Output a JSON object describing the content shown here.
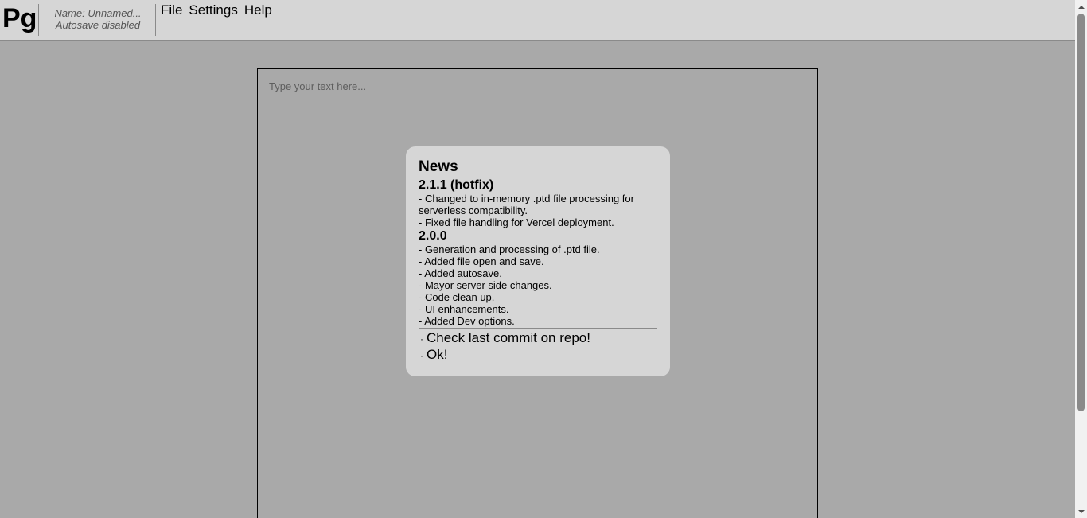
{
  "app": {
    "logo": "Pg",
    "file_name": "Name: Unnamed...",
    "autosave_status": "Autosave disabled"
  },
  "menu": {
    "items": [
      {
        "label": "File"
      },
      {
        "label": "Settings"
      },
      {
        "label": "Help"
      }
    ]
  },
  "editor": {
    "placeholder": "Type your text here..."
  },
  "news_modal": {
    "title": "News",
    "releases": [
      {
        "version": "2.1.1 (hotfix)",
        "changes": [
          "- Changed to in-memory .ptd file processing for serverless compatibility.",
          "- Fixed file handling for Vercel deployment."
        ]
      },
      {
        "version": "2.0.0",
        "changes": [
          "- Generation and processing of .ptd file.",
          "- Added file open and save.",
          "- Added autosave.",
          "- Mayor server side changes.",
          "- Code clean up.",
          "- UI enhancements.",
          "- Added Dev options."
        ]
      }
    ],
    "bullet": "·",
    "actions": [
      {
        "label": "Check last commit on repo!"
      },
      {
        "label": "Ok!"
      }
    ]
  },
  "icons": {
    "scroll_up": "triangle-up-icon",
    "scroll_down": "triangle-down-icon"
  },
  "colors": {
    "page_background": "#a9a9a9",
    "toolbar_background": "#d6d6d6",
    "modal_background": "#d6d6d6"
  }
}
